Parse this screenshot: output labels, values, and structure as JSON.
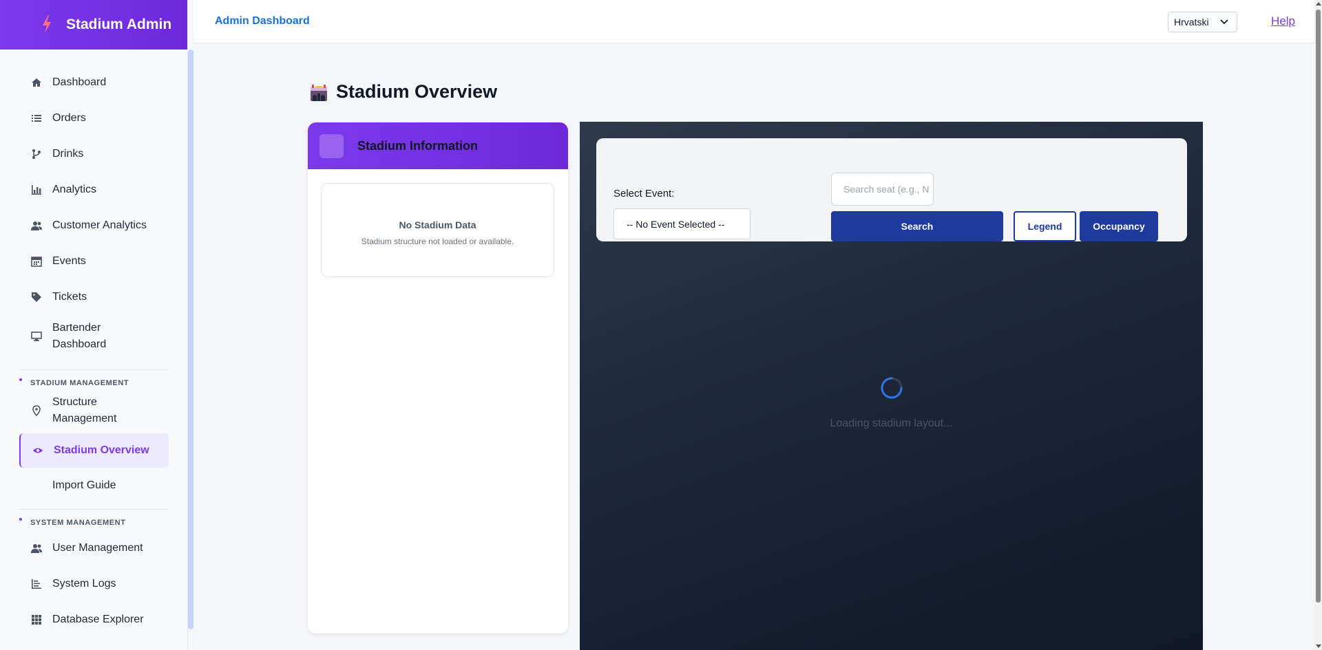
{
  "app": {
    "title": "Stadium Admin"
  },
  "sidebar": {
    "items": [
      {
        "label": "Dashboard",
        "icon": "home-icon"
      },
      {
        "label": "Orders",
        "icon": "list-icon"
      },
      {
        "label": "Drinks",
        "icon": "branch-icon"
      },
      {
        "label": "Analytics",
        "icon": "bar-chart-icon"
      },
      {
        "label": "Customer Analytics",
        "icon": "users-icon"
      },
      {
        "label": "Events",
        "icon": "calendar-icon"
      },
      {
        "label": "Tickets",
        "icon": "tag-icon"
      },
      {
        "label": "Bartender Dashboard",
        "icon": "monitor-icon"
      }
    ],
    "stadium_section": {
      "label": "STADIUM MANAGEMENT",
      "items": [
        {
          "label": "Structure Management",
          "icon": "pin-icon"
        },
        {
          "label": "Stadium Overview",
          "icon": "eye-icon"
        },
        {
          "label": "Import Guide",
          "icon": ""
        }
      ]
    },
    "system_section": {
      "label": "SYSTEM MANAGEMENT",
      "items": [
        {
          "label": "User Management",
          "icon": "users-icon"
        },
        {
          "label": "System Logs",
          "icon": "logs-icon"
        },
        {
          "label": "Database Explorer",
          "icon": "grid-icon"
        }
      ]
    }
  },
  "header": {
    "breadcrumb": "Admin Dashboard",
    "language": "Hrvatski",
    "help": "Help"
  },
  "main": {
    "title": "Stadium Overview",
    "info": {
      "title": "Stadium Information",
      "empty_title": "No Stadium Data",
      "empty_text": "Stadium structure not loaded or available."
    },
    "controls": {
      "event_label": "Select Event:",
      "event_selected": "-- No Event Selected --",
      "search_placeholder": "Search seat (e.g., N",
      "search_button": "Search",
      "legend_button": "Legend",
      "occupancy_button": "Occupancy"
    },
    "loading_text": "Loading stadium layout..."
  },
  "colors": {
    "accent": "#7c3aed",
    "primary_button": "#1e3a9f",
    "link": "#1d6fd8"
  }
}
